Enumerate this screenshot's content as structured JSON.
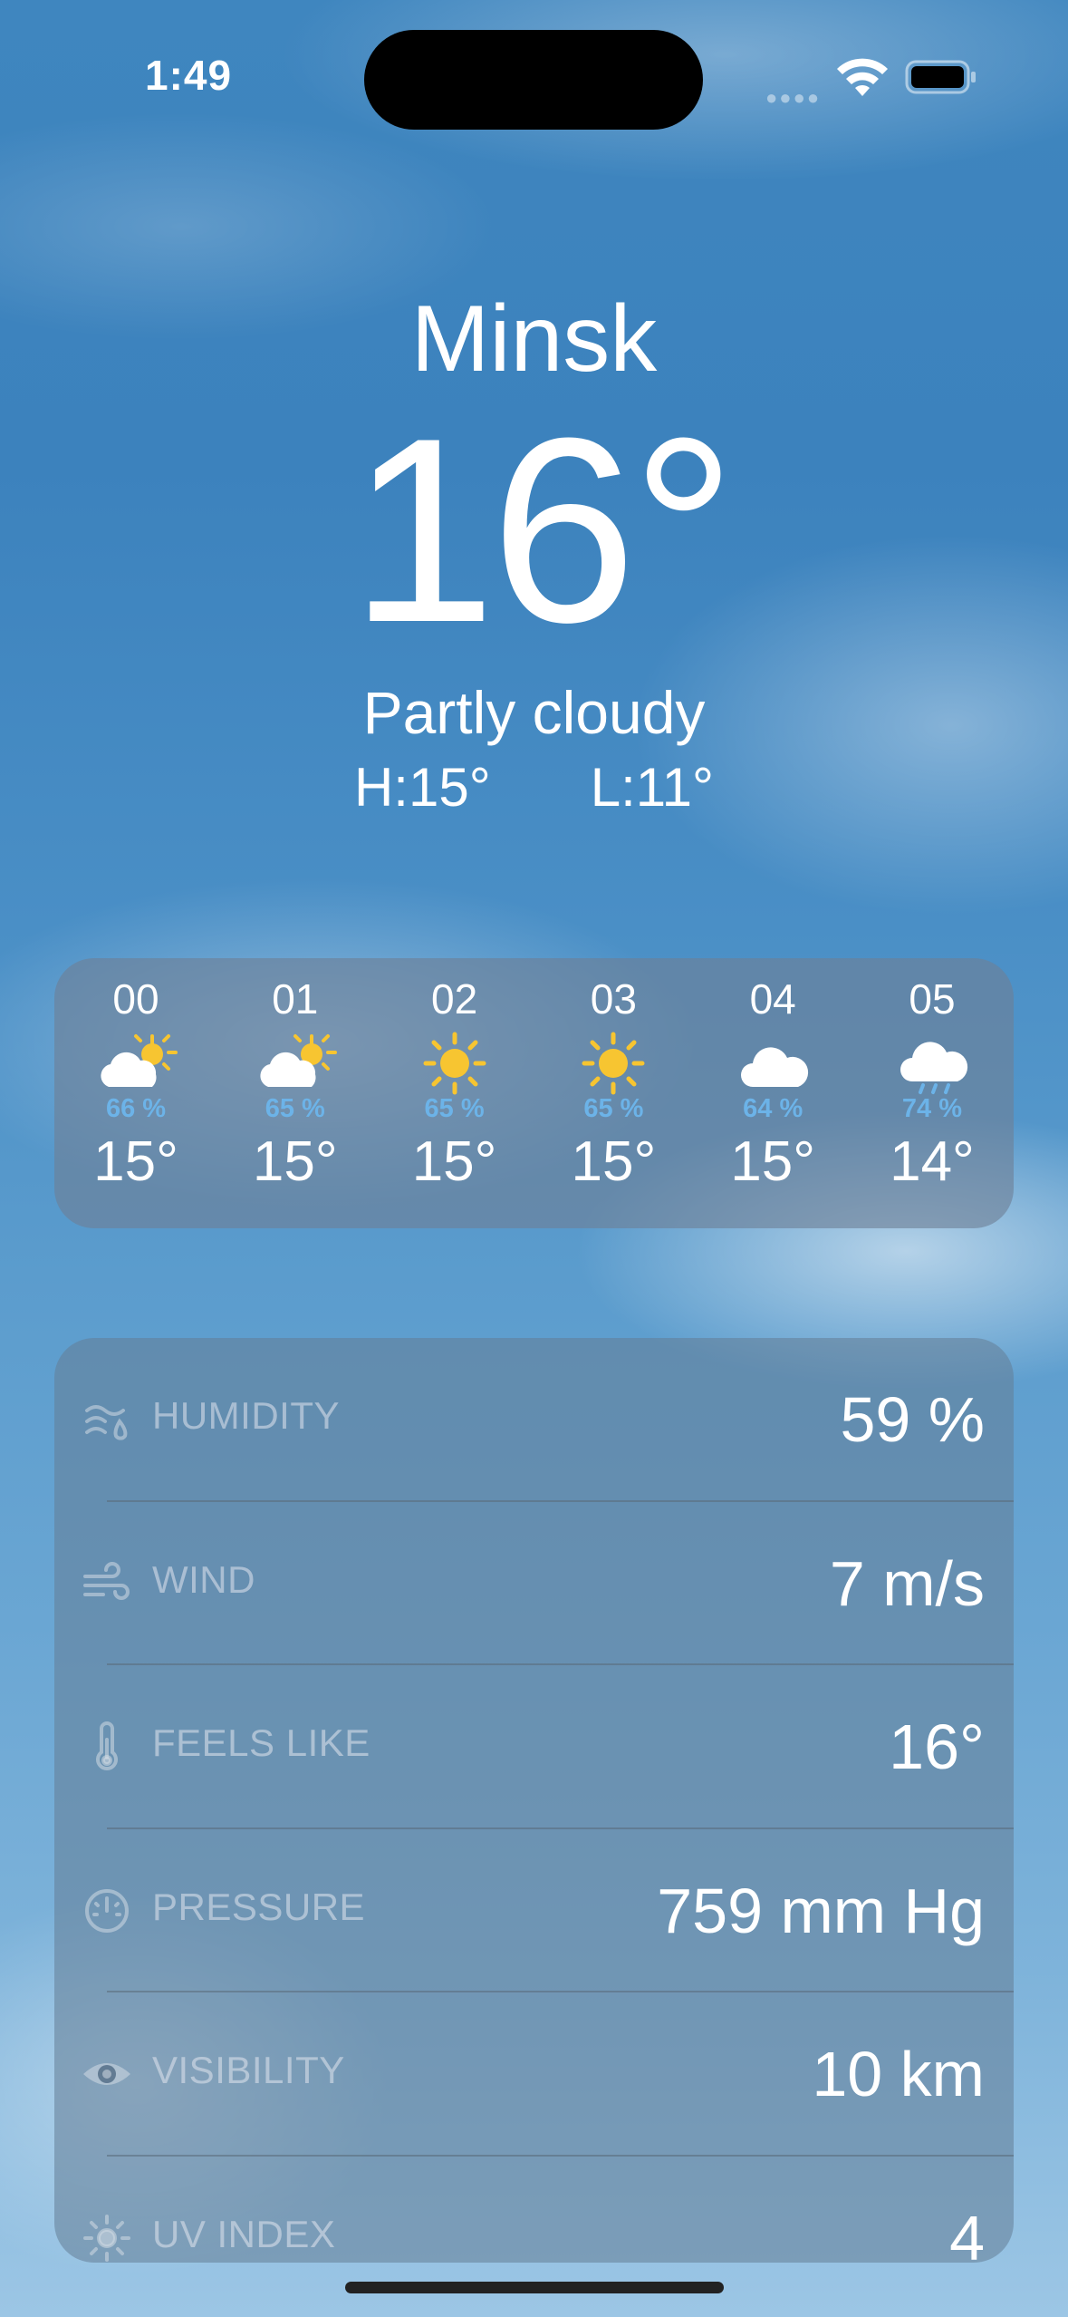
{
  "status_bar": {
    "time": "1:49"
  },
  "header": {
    "city": "Minsk",
    "temperature": "16°",
    "condition": "Partly cloudy",
    "high": "H:15°",
    "low": "L:11°"
  },
  "hourly": [
    {
      "hour": "00",
      "icon": "partly-cloudy-icon",
      "precip": "66 %",
      "temp": "15°"
    },
    {
      "hour": "01",
      "icon": "partly-cloudy-icon",
      "precip": "65 %",
      "temp": "15°"
    },
    {
      "hour": "02",
      "icon": "sun-icon",
      "precip": "65 %",
      "temp": "15°"
    },
    {
      "hour": "03",
      "icon": "sun-icon",
      "precip": "65 %",
      "temp": "15°"
    },
    {
      "hour": "04",
      "icon": "cloud-icon",
      "precip": "64 %",
      "temp": "15°"
    },
    {
      "hour": "05",
      "icon": "rain-cloud-icon",
      "precip": "74 %",
      "temp": "14°"
    }
  ],
  "details": [
    {
      "icon": "humidity-icon",
      "label": "HUMIDITY",
      "value": "59 %"
    },
    {
      "icon": "wind-icon",
      "label": "WIND",
      "value": "7 m/s"
    },
    {
      "icon": "thermometer-icon",
      "label": "FEELS LIKE",
      "value": "16°"
    },
    {
      "icon": "pressure-gauge-icon",
      "label": "PRESSURE",
      "value": "759 mm Hg"
    },
    {
      "icon": "eye-icon",
      "label": "VISIBILITY",
      "value": "10 km"
    },
    {
      "icon": "sun-outline-icon",
      "label": "UV INDEX",
      "value": "4"
    }
  ],
  "colors": {
    "precip_text": "#6cb3e8",
    "sun": "#f7c531",
    "card_bg": "#6e8096"
  }
}
